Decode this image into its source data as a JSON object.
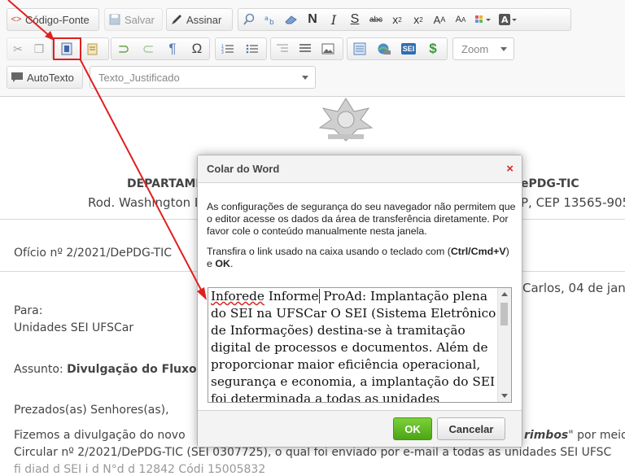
{
  "toolbar": {
    "source_label": "Código-Fonte",
    "save_label": "Salvar",
    "sign_label": "Assinar",
    "zoom_label": "Zoom",
    "autotext_label": "AutoTexto",
    "style_value": "Texto_Justificado",
    "sei_label": "SEI"
  },
  "document": {
    "dept_left": "DEPARTAME",
    "dept_right": "ePDG-TIC",
    "address_left": "Rod. Washington Lu",
    "address_right": "P, CEP 13565-905",
    "office_ref": "Ofício nº 2/2021/DePDG-TIC",
    "date_text": "Carlos, 04 de jane",
    "para_label": "Para:",
    "recipient": "Unidades SEI UFSCar",
    "subject_label": "Assunto:",
    "subject_text": "Divulgação do Fluxo do",
    "greeting": "Prezados(as) Senhores(as),",
    "body_line1_start": "Fizemos a divulgação do novo",
    "body_line1_end": "rimbos",
    "body_line1_tail": "\" por meio",
    "body_line2": "Circular nº 2/2021/DePDG-TIC (SEI 0307725),  o qual foi enviado por e-mail a todas as unidades SEI UFSC",
    "body_line3": "fi                    diad      d  SEI                 i d  N°d                   d  12842  Códi                   15005832"
  },
  "dialog": {
    "title": "Colar do Word",
    "close_symbol": "×",
    "paragraph1": "As configurações de segurança do seu navegador não permitem que o editor acesse os dados da área de transferência diretamente. Por favor cole o conteúdo manualmente nesta janela.",
    "paragraph2_start": "Transfira o link usado na caixa usando o teclado com (",
    "paragraph2_shortcut": "Ctrl/Cmd+V",
    "paragraph2_mid": ") e ",
    "paragraph2_ok": "OK",
    "paragraph2_end": ".",
    "paste_word1": "Inforede",
    "paste_word2": "Informe",
    "paste_rest": "ProAd: Implantação plena do SEI na UFSCar O SEI (Sistema Eletrônico de Informações) destina-se à tramitação digital de processos e documentos. Além de proporcionar maior eficiência operacional, segurança e economia, a implantação do SEI foi determinada a todas as unidades vinculadas ao Ministério da Educação (MEC), por",
    "ok_label": "OK",
    "cancel_label": "Cancelar"
  },
  "colors": {
    "annotation_red": "#e02020",
    "ok_green": "#5cb91f",
    "close_red": "#d62b2b"
  }
}
